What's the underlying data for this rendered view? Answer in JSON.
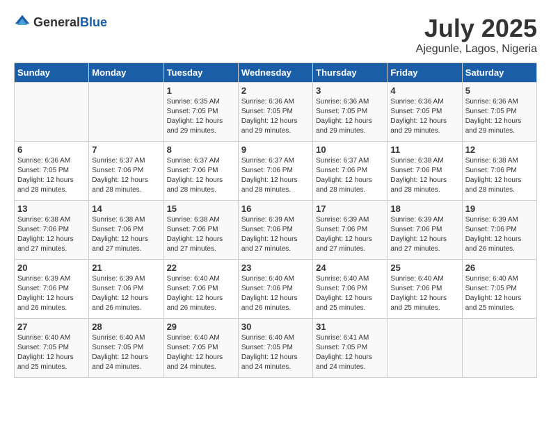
{
  "logo": {
    "general": "General",
    "blue": "Blue"
  },
  "header": {
    "month_year": "July 2025",
    "location": "Ajegunle, Lagos, Nigeria"
  },
  "weekdays": [
    "Sunday",
    "Monday",
    "Tuesday",
    "Wednesday",
    "Thursday",
    "Friday",
    "Saturday"
  ],
  "weeks": [
    [
      {
        "day": "",
        "info": ""
      },
      {
        "day": "",
        "info": ""
      },
      {
        "day": "1",
        "info": "Sunrise: 6:35 AM\nSunset: 7:05 PM\nDaylight: 12 hours and 29 minutes."
      },
      {
        "day": "2",
        "info": "Sunrise: 6:36 AM\nSunset: 7:05 PM\nDaylight: 12 hours and 29 minutes."
      },
      {
        "day": "3",
        "info": "Sunrise: 6:36 AM\nSunset: 7:05 PM\nDaylight: 12 hours and 29 minutes."
      },
      {
        "day": "4",
        "info": "Sunrise: 6:36 AM\nSunset: 7:05 PM\nDaylight: 12 hours and 29 minutes."
      },
      {
        "day": "5",
        "info": "Sunrise: 6:36 AM\nSunset: 7:05 PM\nDaylight: 12 hours and 29 minutes."
      }
    ],
    [
      {
        "day": "6",
        "info": "Sunrise: 6:36 AM\nSunset: 7:05 PM\nDaylight: 12 hours and 28 minutes."
      },
      {
        "day": "7",
        "info": "Sunrise: 6:37 AM\nSunset: 7:06 PM\nDaylight: 12 hours and 28 minutes."
      },
      {
        "day": "8",
        "info": "Sunrise: 6:37 AM\nSunset: 7:06 PM\nDaylight: 12 hours and 28 minutes."
      },
      {
        "day": "9",
        "info": "Sunrise: 6:37 AM\nSunset: 7:06 PM\nDaylight: 12 hours and 28 minutes."
      },
      {
        "day": "10",
        "info": "Sunrise: 6:37 AM\nSunset: 7:06 PM\nDaylight: 12 hours and 28 minutes."
      },
      {
        "day": "11",
        "info": "Sunrise: 6:38 AM\nSunset: 7:06 PM\nDaylight: 12 hours and 28 minutes."
      },
      {
        "day": "12",
        "info": "Sunrise: 6:38 AM\nSunset: 7:06 PM\nDaylight: 12 hours and 28 minutes."
      }
    ],
    [
      {
        "day": "13",
        "info": "Sunrise: 6:38 AM\nSunset: 7:06 PM\nDaylight: 12 hours and 27 minutes."
      },
      {
        "day": "14",
        "info": "Sunrise: 6:38 AM\nSunset: 7:06 PM\nDaylight: 12 hours and 27 minutes."
      },
      {
        "day": "15",
        "info": "Sunrise: 6:38 AM\nSunset: 7:06 PM\nDaylight: 12 hours and 27 minutes."
      },
      {
        "day": "16",
        "info": "Sunrise: 6:39 AM\nSunset: 7:06 PM\nDaylight: 12 hours and 27 minutes."
      },
      {
        "day": "17",
        "info": "Sunrise: 6:39 AM\nSunset: 7:06 PM\nDaylight: 12 hours and 27 minutes."
      },
      {
        "day": "18",
        "info": "Sunrise: 6:39 AM\nSunset: 7:06 PM\nDaylight: 12 hours and 27 minutes."
      },
      {
        "day": "19",
        "info": "Sunrise: 6:39 AM\nSunset: 7:06 PM\nDaylight: 12 hours and 26 minutes."
      }
    ],
    [
      {
        "day": "20",
        "info": "Sunrise: 6:39 AM\nSunset: 7:06 PM\nDaylight: 12 hours and 26 minutes."
      },
      {
        "day": "21",
        "info": "Sunrise: 6:39 AM\nSunset: 7:06 PM\nDaylight: 12 hours and 26 minutes."
      },
      {
        "day": "22",
        "info": "Sunrise: 6:40 AM\nSunset: 7:06 PM\nDaylight: 12 hours and 26 minutes."
      },
      {
        "day": "23",
        "info": "Sunrise: 6:40 AM\nSunset: 7:06 PM\nDaylight: 12 hours and 26 minutes."
      },
      {
        "day": "24",
        "info": "Sunrise: 6:40 AM\nSunset: 7:06 PM\nDaylight: 12 hours and 25 minutes."
      },
      {
        "day": "25",
        "info": "Sunrise: 6:40 AM\nSunset: 7:06 PM\nDaylight: 12 hours and 25 minutes."
      },
      {
        "day": "26",
        "info": "Sunrise: 6:40 AM\nSunset: 7:05 PM\nDaylight: 12 hours and 25 minutes."
      }
    ],
    [
      {
        "day": "27",
        "info": "Sunrise: 6:40 AM\nSunset: 7:05 PM\nDaylight: 12 hours and 25 minutes."
      },
      {
        "day": "28",
        "info": "Sunrise: 6:40 AM\nSunset: 7:05 PM\nDaylight: 12 hours and 24 minutes."
      },
      {
        "day": "29",
        "info": "Sunrise: 6:40 AM\nSunset: 7:05 PM\nDaylight: 12 hours and 24 minutes."
      },
      {
        "day": "30",
        "info": "Sunrise: 6:40 AM\nSunset: 7:05 PM\nDaylight: 12 hours and 24 minutes."
      },
      {
        "day": "31",
        "info": "Sunrise: 6:41 AM\nSunset: 7:05 PM\nDaylight: 12 hours and 24 minutes."
      },
      {
        "day": "",
        "info": ""
      },
      {
        "day": "",
        "info": ""
      }
    ]
  ]
}
